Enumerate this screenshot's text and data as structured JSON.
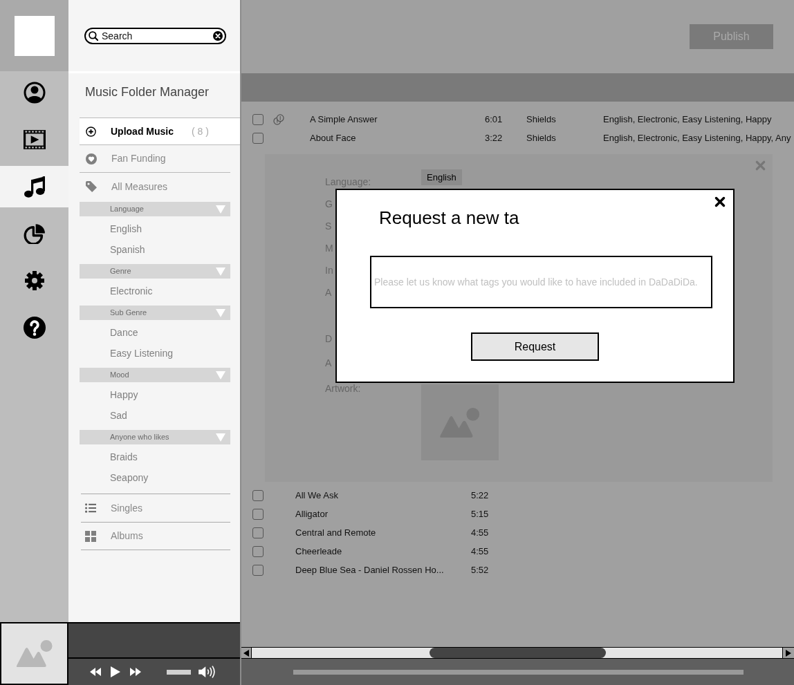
{
  "rail": {
    "items": [
      {
        "kind": "profile",
        "selected": false
      },
      {
        "kind": "video",
        "selected": false
      },
      {
        "kind": "music",
        "selected": true
      },
      {
        "kind": "stats",
        "selected": false
      },
      {
        "kind": "settings",
        "selected": false
      },
      {
        "kind": "help",
        "selected": false
      }
    ]
  },
  "sidebar": {
    "search": {
      "placeholder": "Search"
    },
    "title": "Music Folder Manager",
    "menu": [
      {
        "kind": "upload",
        "label": "Upload Music",
        "count": "( 8 )",
        "selected": true
      },
      {
        "kind": "funding",
        "label": "Fan Funding",
        "selected": false
      },
      {
        "kind": "measures",
        "label": "All Measures",
        "selected": false
      }
    ],
    "measures": [
      {
        "title": "Language",
        "expanded": true,
        "items": [
          "English",
          "Spanish"
        ]
      },
      {
        "title": "Genre",
        "expanded": true,
        "items": [
          "Electronic"
        ]
      },
      {
        "title": "Sub Genre",
        "expanded": true,
        "items": [
          "Dance",
          "Easy Listening"
        ]
      },
      {
        "title": "Mood",
        "expanded": true,
        "items": [
          "Happy",
          "Sad"
        ]
      },
      {
        "title": "Anyone who likes",
        "expanded": true,
        "items": [
          "Braids",
          "Seapony"
        ]
      }
    ],
    "views": [
      {
        "kind": "list",
        "label": "Singles",
        "selected": false
      },
      {
        "kind": "grid",
        "label": "Albums",
        "selected": false
      }
    ]
  },
  "player": {
    "volume": {
      "level": 1
    }
  },
  "toolbar": {
    "publish_button": "Publish"
  },
  "tracks": [
    {
      "title": "A Simple Answer",
      "duration": "6:01",
      "artist": "Shields",
      "tags": "English, Electronic, Easy Listening, Happy",
      "fan_funded": true,
      "checked": false
    },
    {
      "title": "About Face",
      "duration": "3:22",
      "artist": "Shields",
      "tags": "English, Electronic, Easy Listening, Happy, Any",
      "fan_funded": false,
      "checked": false
    }
  ],
  "track_details": {
    "fields": [
      {
        "kind": "tags",
        "label": "Language:",
        "tags": [
          "English"
        ]
      },
      {
        "kind": "text",
        "label": "G"
      },
      {
        "kind": "text",
        "label": "S"
      },
      {
        "kind": "text",
        "label": "M"
      },
      {
        "kind": "text",
        "label": "In"
      },
      {
        "kind": "text",
        "label": "A"
      },
      {
        "kind": "text",
        "label": "D"
      },
      {
        "kind": "text",
        "label": "A"
      },
      {
        "kind": "artwork",
        "label": "Artwork:"
      }
    ]
  },
  "more_tracks": [
    {
      "title": "All We Ask",
      "duration": "5:22",
      "checked": false
    },
    {
      "title": "Alligator",
      "duration": "5:15",
      "checked": false
    },
    {
      "title": "Central and Remote",
      "duration": "4:55",
      "checked": false
    },
    {
      "title": "Cheerleade",
      "duration": "4:55",
      "checked": false
    },
    {
      "title": "Deep Blue Sea - Daniel Rossen Ho...",
      "duration": "5:52",
      "checked": false
    }
  ],
  "dialog": {
    "title": "Request a new ta",
    "input": {
      "placeholder": "Please let us know what tags you would like to have included in DaDaDiDa."
    },
    "button": "Request"
  }
}
